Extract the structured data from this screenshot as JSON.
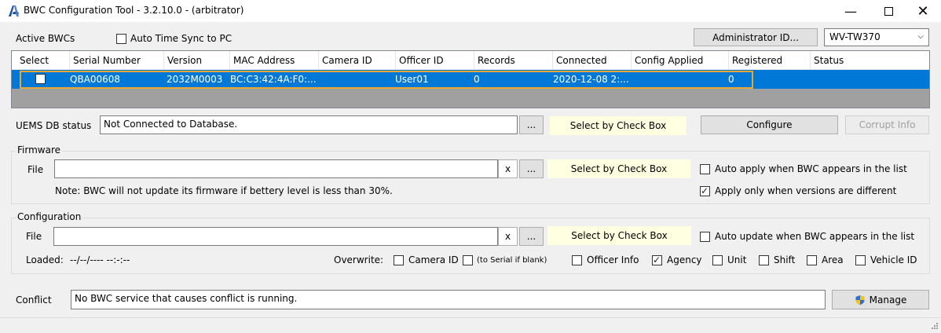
{
  "window": {
    "title": "BWC Configuration Tool - 3.2.10.0 - (arbitrator)"
  },
  "top": {
    "active_bwcs_label": "Active BWCs",
    "auto_time_sync_label": "Auto Time Sync to PC",
    "admin_button": "Administrator ID...",
    "model_select": "WV-TW370"
  },
  "table": {
    "columns": [
      "Select",
      "Serial Number",
      "Version",
      "MAC Address",
      "Camera ID",
      "Officer ID",
      "Records",
      "Connected",
      "Config Applied",
      "Registered",
      "Status"
    ],
    "rows": [
      {
        "serial": "QBA00608",
        "version": "2032M0003",
        "mac": "BC:C3:42:4A:F0:...",
        "camera_id": "",
        "officer_id": "User01",
        "records": "0",
        "connected": "2020-12-08 2:...",
        "config_applied": "",
        "registered": "0",
        "status": ""
      }
    ]
  },
  "uems": {
    "label": "UEMS DB status",
    "value": "Not Connected to Database.",
    "browse": "...",
    "select_hint": "Select by Check Box",
    "configure_button": "Configure",
    "corrupt_button": "Corrupt Info"
  },
  "firmware": {
    "group_label": "Firmware",
    "file_label": "File",
    "file_value": "",
    "clear": "x",
    "browse": "...",
    "select_hint": "Select by Check Box",
    "auto_apply_label": "Auto apply when BWC appears in the list",
    "apply_only_label": "Apply only when versions are different",
    "note": "Note: BWC will not update its firmware if bettery level is less than 30%."
  },
  "configuration": {
    "group_label": "Configuration",
    "file_label": "File",
    "file_value": "",
    "clear": "x",
    "browse": "...",
    "select_hint": "Select by Check Box",
    "auto_update_label": "Auto update when BWC appears in the list",
    "loaded_label": "Loaded:",
    "loaded_value": "--/--/---- --:-:--",
    "overwrite_label": "Overwrite:",
    "options": {
      "camera_id": "Camera ID",
      "serial_hint": "(to Serial if blank)",
      "officer_info": "Officer Info",
      "agency": "Agency",
      "unit": "Unit",
      "shift": "Shift",
      "area": "Area",
      "vehicle_id": "Vehicle ID"
    }
  },
  "conflict": {
    "label": "Conflict",
    "value": "No BWC service that causes conflict is running.",
    "manage_button": "Manage"
  },
  "colors": {
    "selection": "#0078d7",
    "highlight": "#e8a735",
    "hint_bg": "#ffffe1"
  }
}
